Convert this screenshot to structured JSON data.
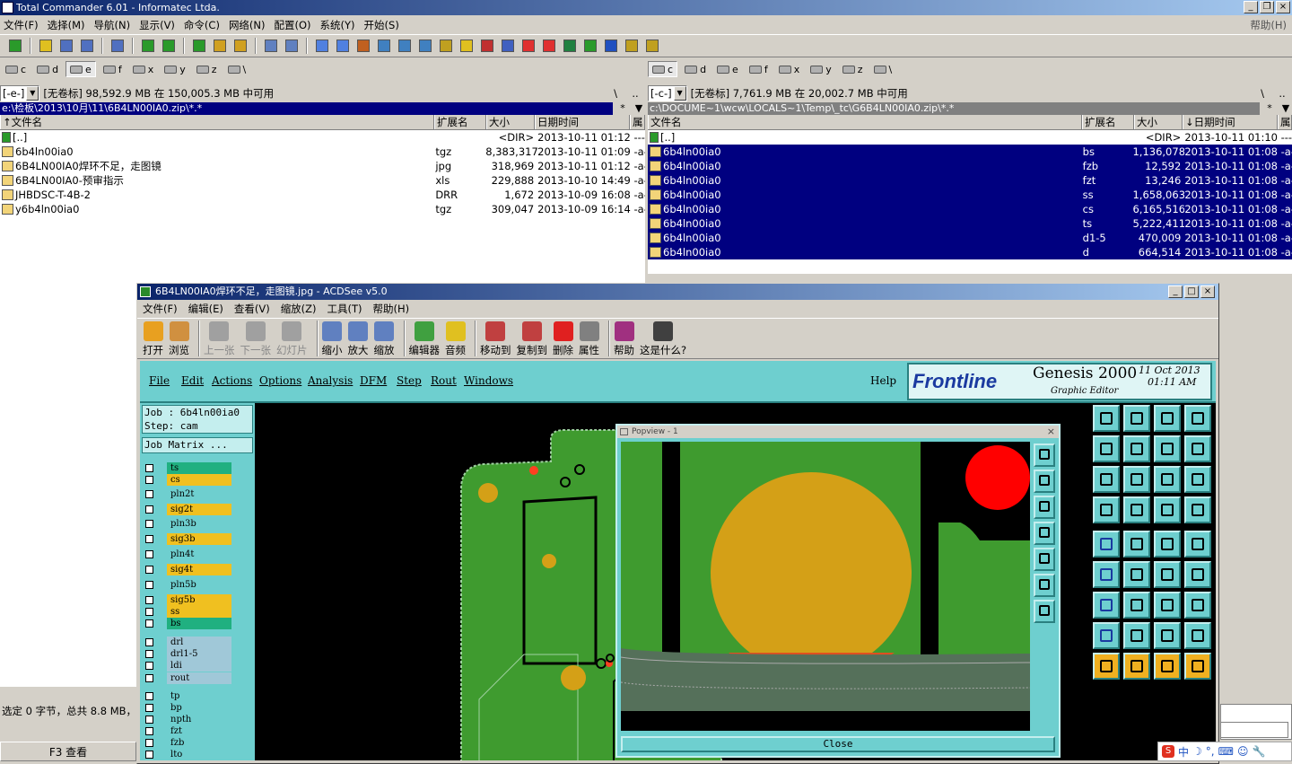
{
  "tc": {
    "title": "Total Commander 6.01 - Informatec Ltda.",
    "menu": [
      "文件(F)",
      "选择(M)",
      "导航(N)",
      "显示(V)",
      "命令(C)",
      "网络(N)",
      "配置(O)",
      "系统(Y)",
      "开始(S)"
    ],
    "help": "帮助(H)",
    "drives_left": [
      "c",
      "d",
      "e",
      "f",
      "x",
      "y",
      "z",
      "\\"
    ],
    "drives_right": [
      "c",
      "d",
      "e",
      "f",
      "x",
      "y",
      "z",
      "\\"
    ],
    "left": {
      "drive_combo": "[-e-]",
      "volume": "[无卷标]  98,592.9 MB 在 150,005.3 MB 中可用",
      "root_btn": "\\",
      "up_btn": "..",
      "path": "e:\\检板\\2013\\10月\\11\\6B4LN00IA0.zip\\*.*",
      "star": "*",
      "columns": [
        "↑文件名",
        "扩展名",
        "大小",
        "日期时间",
        "属"
      ],
      "rows": [
        {
          "name": "[..]",
          "ext": "",
          "size": "<DIR>",
          "date": "2013-10-11 01:12 ----"
        },
        {
          "name": "6b4ln00ia0",
          "ext": "tgz",
          "size": "8,383,317",
          "date": "2013-10-11 01:09 -a-"
        },
        {
          "name": "6B4LN00IA0焊环不足，走图镜",
          "ext": "jpg",
          "size": "318,969",
          "date": "2013-10-11 01:12 -a-"
        },
        {
          "name": "6B4LN00IA0-预审指示",
          "ext": "xls",
          "size": "229,888",
          "date": "2013-10-10 14:49 -a-"
        },
        {
          "name": "JHBDSC-T-4B-2",
          "ext": "DRR",
          "size": "1,672",
          "date": "2013-10-09 16:08 -a-"
        },
        {
          "name": "y6b4ln00ia0",
          "ext": "tgz",
          "size": "309,047",
          "date": "2013-10-09 16:14 -a-"
        }
      ],
      "status": "选定 0 字节，总共 8.8 MB，",
      "f3": "F3 查看"
    },
    "right": {
      "drive_combo": "[-c-]",
      "volume": "[无卷标]  7,761.9 MB 在 20,002.7 MB 中可用",
      "root_btn": "\\",
      "up_btn": "..",
      "path": "c:\\DOCUME~1\\wcw\\LOCALS~1\\Temp\\_tc\\G6B4LN00IA0.zip\\*.*",
      "star": "*",
      "columns": [
        "文件名",
        "扩展名",
        "大小",
        "↓日期时间",
        "属"
      ],
      "rows": [
        {
          "name": "[..]",
          "ext": "",
          "size": "<DIR>",
          "date": "2013-10-11 01:10 ----"
        },
        {
          "name": "6b4ln00ia0",
          "ext": "bs",
          "size": "1,136,078",
          "date": "2013-10-11 01:08 -a-"
        },
        {
          "name": "6b4ln00ia0",
          "ext": "fzb",
          "size": "12,592",
          "date": "2013-10-11 01:08 -a-"
        },
        {
          "name": "6b4ln00ia0",
          "ext": "fzt",
          "size": "13,246",
          "date": "2013-10-11 01:08 -a-"
        },
        {
          "name": "6b4ln00ia0",
          "ext": "ss",
          "size": "1,658,063",
          "date": "2013-10-11 01:08 -a-"
        },
        {
          "name": "6b4ln00ia0",
          "ext": "cs",
          "size": "6,165,516",
          "date": "2013-10-11 01:08 -a-"
        },
        {
          "name": "6b4ln00ia0",
          "ext": "ts",
          "size": "5,222,411",
          "date": "2013-10-11 01:08 -a-"
        },
        {
          "name": "6b4ln00ia0",
          "ext": "d1-5",
          "size": "470,009",
          "date": "2013-10-11 01:08 -a-"
        },
        {
          "name": "6b4ln00ia0",
          "ext": "d",
          "size": "664,514",
          "date": "2013-10-11 01:08 -a-"
        }
      ]
    }
  },
  "acdsee": {
    "title": "6B4LN00IA0焊环不足，走图镜.jpg - ACDSee v5.0",
    "menu": [
      "文件(F)",
      "编辑(E)",
      "查看(V)",
      "缩放(Z)",
      "工具(T)",
      "帮助(H)"
    ],
    "tools": [
      {
        "label": "打开",
        "icon": "open-icon",
        "color": "#e8a020",
        "disabled": false
      },
      {
        "label": "浏览",
        "icon": "browse-icon",
        "color": "#d09040",
        "disabled": false
      },
      {
        "label": "上一张",
        "icon": "prev-image-icon",
        "color": "#a0a0a0",
        "disabled": true
      },
      {
        "label": "下一张",
        "icon": "next-image-icon",
        "color": "#a0a0a0",
        "disabled": true
      },
      {
        "label": "幻灯片",
        "icon": "slideshow-icon",
        "color": "#a0a0a0",
        "disabled": true
      },
      {
        "label": "缩小",
        "icon": "zoom-out-icon",
        "color": "#6080c0",
        "disabled": false
      },
      {
        "label": "放大",
        "icon": "zoom-in-icon",
        "color": "#6080c0",
        "disabled": false
      },
      {
        "label": "缩放",
        "icon": "zoom-icon",
        "color": "#6080c0",
        "disabled": false
      },
      {
        "label": "编辑器",
        "icon": "editor-icon",
        "color": "#40a040",
        "disabled": false
      },
      {
        "label": "音频",
        "icon": "audio-icon",
        "color": "#e0c020",
        "disabled": false
      },
      {
        "label": "移动到",
        "icon": "move-to-icon",
        "color": "#c04040",
        "disabled": false
      },
      {
        "label": "复制到",
        "icon": "copy-to-icon",
        "color": "#c04040",
        "disabled": false
      },
      {
        "label": "删除",
        "icon": "delete-icon",
        "color": "#e02020",
        "disabled": false
      },
      {
        "label": "属性",
        "icon": "properties-icon",
        "color": "#808080",
        "disabled": false
      },
      {
        "label": "帮助",
        "icon": "help-book-icon",
        "color": "#a03080",
        "disabled": false
      },
      {
        "label": "这是什么?",
        "icon": "whats-this-icon",
        "color": "#404040",
        "disabled": false
      }
    ]
  },
  "genesis": {
    "menu": [
      "File",
      "Edit",
      "Actions",
      "Options",
      "Analysis",
      "DFM",
      "Step",
      "Rout",
      "Windows"
    ],
    "help": "Help",
    "logo": "Frontline",
    "product": "Genesis 2000",
    "subtitle": "Graphic Editor",
    "date": "11 Oct 2013",
    "time": "01:11 AM",
    "job": "Job : 6b4ln00ia0",
    "step": "Step: cam",
    "job_matrix": "Job Matrix ...",
    "layers": [
      {
        "name": "ts",
        "color": "#20b080"
      },
      {
        "name": "cs",
        "color": "#f0c020"
      },
      {
        "name": "pln2t",
        "color": "#6ecfcf"
      },
      {
        "name": "sig2t",
        "color": "#f0c020"
      },
      {
        "name": "pln3b",
        "color": "#6ecfcf"
      },
      {
        "name": "sig3b",
        "color": "#f0c020"
      },
      {
        "name": "pln4t",
        "color": "#6ecfcf"
      },
      {
        "name": "sig4t",
        "color": "#f0c020"
      },
      {
        "name": "pln5b",
        "color": "#6ecfcf"
      },
      {
        "name": "sig5b",
        "color": "#f0c020"
      },
      {
        "name": "ss",
        "color": "#f0c020"
      },
      {
        "name": "bs",
        "color": "#20b080"
      },
      {
        "name": "drl",
        "color": "#a0c8d8"
      },
      {
        "name": "drl1-5",
        "color": "#a0c8d8"
      },
      {
        "name": "ldi",
        "color": "#a0c8d8"
      },
      {
        "name": "rout",
        "color": "#a0c8d8"
      },
      {
        "name": "tp",
        "color": "#6ecfcf"
      },
      {
        "name": "bp",
        "color": "#6ecfcf"
      },
      {
        "name": "npth",
        "color": "#6ecfcf"
      },
      {
        "name": "fzt",
        "color": "#6ecfcf"
      },
      {
        "name": "fzb",
        "color": "#6ecfcf"
      },
      {
        "name": "lto",
        "color": "#6ecfcf"
      }
    ],
    "popview_title": "Popview - 1",
    "close": "Close",
    "right_tools": [
      "zoom-window-icon",
      "zoom-home-icon",
      "fit-icon",
      "pan-icon",
      "zoom-in-icon",
      "zoom-out-icon",
      "zoom-12-icon",
      "query-icon",
      "snap-icon",
      "grid-icon",
      "measure-icon",
      "layers-icon",
      "pad-icon",
      "line-icon",
      "ruler-icon",
      "circle-icon",
      "node-icon",
      "cross-icon",
      "arc-icon",
      "arc2-icon",
      "angle-icon",
      "slash-icon",
      "rotate-icon",
      "mirror-icon",
      "feature-icon",
      "minus-icon",
      "size-icon",
      "group-icon",
      "poly-icon",
      "triangle-icon",
      "area-icon",
      "area2-icon",
      "pointer-icon",
      "select-icon",
      "edit-icon",
      "move-icon"
    ]
  },
  "tray": {
    "text": "中"
  },
  "colors": {
    "selection": "#000080",
    "inactive_path": "#808080",
    "genesis_panel": "#6ecfcf",
    "board_green": "#3f9b2f",
    "pad_gold": "#d4a017",
    "pad_red": "#ff0000"
  }
}
